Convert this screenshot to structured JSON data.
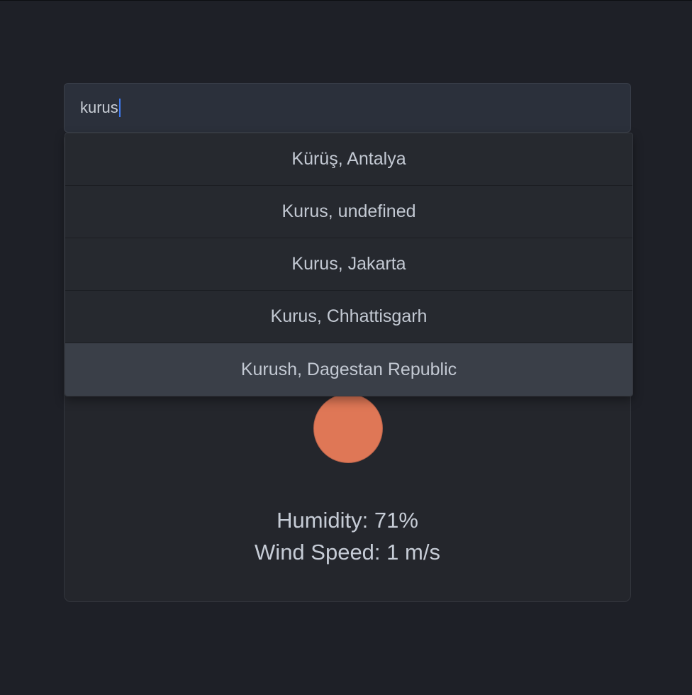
{
  "search": {
    "value": "kurus"
  },
  "suggestions": [
    {
      "label": "Kürüş, Antalya",
      "highlighted": false
    },
    {
      "label": "Kurus, undefined",
      "highlighted": false
    },
    {
      "label": "Kurus, Jakarta",
      "highlighted": false
    },
    {
      "label": "Kurus, Chhattisgarh",
      "highlighted": false
    },
    {
      "label": "Kurush, Dagestan Republic",
      "highlighted": true
    }
  ],
  "weather": {
    "icon": "sun-icon",
    "icon_color": "#df7756",
    "humidity": "Humidity: 71%",
    "wind_speed": "Wind Speed: 1 m/s"
  },
  "colors": {
    "background": "#1e2027",
    "card": "#24262c",
    "input": "#2b303b",
    "caret": "#3f7cf5",
    "highlight": "#3a3f48"
  }
}
